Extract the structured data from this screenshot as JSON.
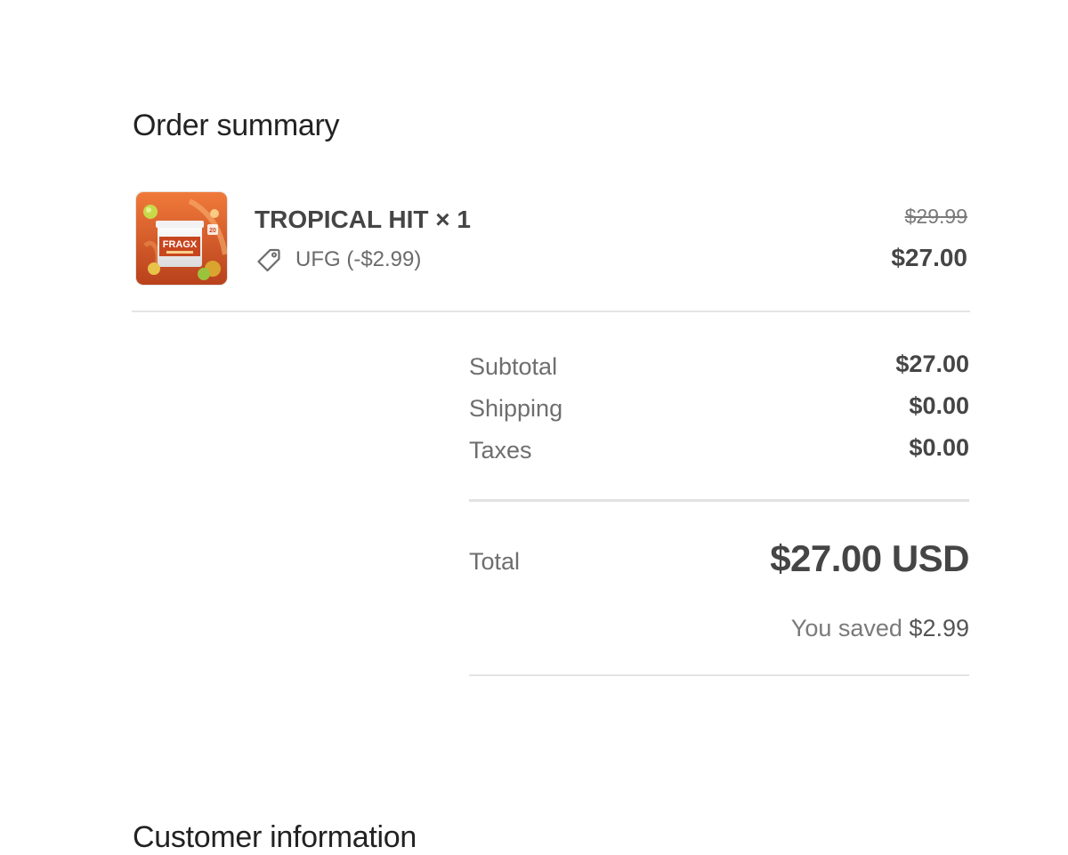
{
  "order_summary": {
    "heading": "Order summary",
    "item": {
      "image_icon": "product-thumbnail",
      "product_brand_on_label": "FRAGX",
      "name": "TROPICAL HIT × 1",
      "discount_code": "UFG (-$2.99)",
      "discount_icon": "tag-icon",
      "original_price": "$29.99",
      "final_price": "$27.00"
    },
    "subtotal": {
      "label": "Subtotal",
      "value": "$27.00"
    },
    "shipping": {
      "label": "Shipping",
      "value": "$0.00"
    },
    "taxes": {
      "label": "Taxes",
      "value": "$0.00"
    },
    "total": {
      "label": "Total",
      "value": "$27.00 USD"
    },
    "savings": {
      "label": "You saved",
      "amount": "$2.99"
    }
  },
  "customer_information": {
    "heading": "Customer information"
  },
  "colors": {
    "text_dark": "#454545",
    "text_muted": "#6e6e6e",
    "divider": "#e4e4e4",
    "product_orange": "#e0622a"
  }
}
